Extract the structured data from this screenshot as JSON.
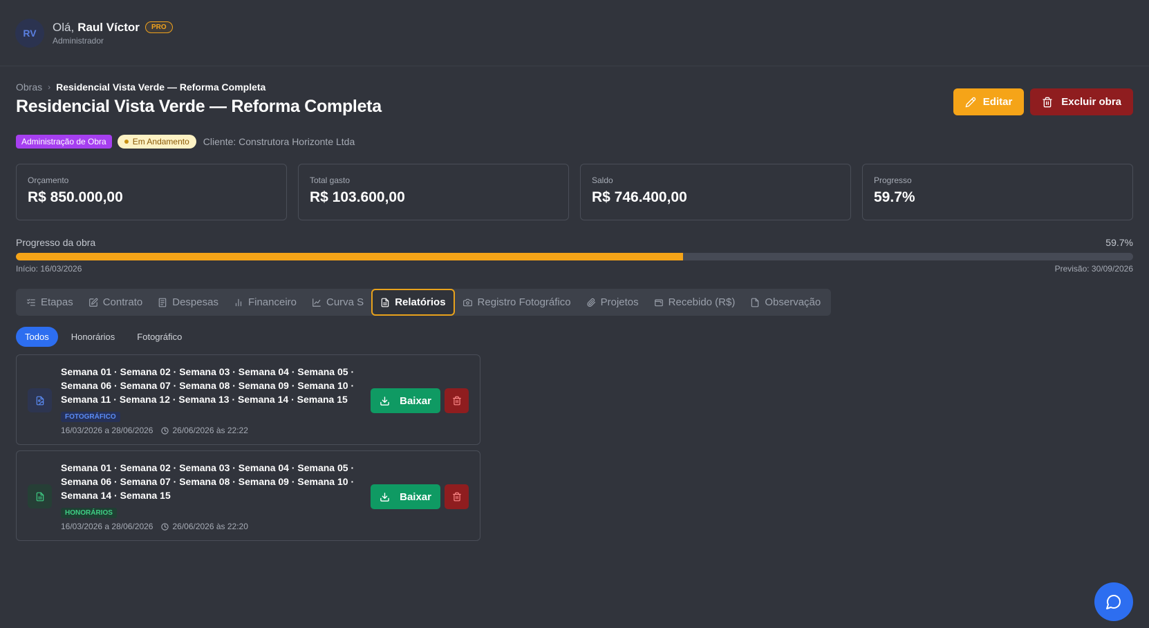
{
  "header": {
    "avatar_initials": "RV",
    "greeting": "Olá,",
    "user_name": "Raul Víctor",
    "badge": "PRO",
    "role": "Administrador"
  },
  "breadcrumb": {
    "root": "Obras",
    "current": "Residencial Vista Verde — Reforma Completa"
  },
  "page": {
    "title": "Residencial Vista Verde — Reforma Completa",
    "edit_label": "Editar",
    "delete_label": "Excluir obra"
  },
  "tags": {
    "type": "Administração de Obra",
    "status": "Em Andamento",
    "client": "Cliente: Construtora Horizonte Ltda"
  },
  "stats": [
    {
      "label": "Orçamento",
      "value": "R$ 850.000,00"
    },
    {
      "label": "Total gasto",
      "value": "R$ 103.600,00"
    },
    {
      "label": "Saldo",
      "value": "R$ 746.400,00"
    },
    {
      "label": "Progresso",
      "value": "59.7%"
    }
  ],
  "progress": {
    "label": "Progresso da obra",
    "value_text": "59.7%",
    "percent": 59.7,
    "start": "Início: 16/03/2026",
    "forecast": "Previsão: 30/09/2026"
  },
  "tabs": [
    {
      "label": "Etapas",
      "icon": "list-check-icon"
    },
    {
      "label": "Contrato",
      "icon": "edit-doc-icon"
    },
    {
      "label": "Despesas",
      "icon": "receipt-icon"
    },
    {
      "label": "Financeiro",
      "icon": "bar-chart-icon"
    },
    {
      "label": "Curva S",
      "icon": "line-chart-icon"
    },
    {
      "label": "Relatórios",
      "icon": "file-text-icon",
      "active": true
    },
    {
      "label": "Registro Fotográfico",
      "icon": "camera-icon"
    },
    {
      "label": "Projetos",
      "icon": "paperclip-icon"
    },
    {
      "label": "Recebido (R$)",
      "icon": "wallet-icon"
    },
    {
      "label": "Observação",
      "icon": "file-icon"
    }
  ],
  "filters": [
    {
      "label": "Todos",
      "active": true
    },
    {
      "label": "Honorários"
    },
    {
      "label": "Fotográfico"
    }
  ],
  "reports": [
    {
      "title_line1": "Semana 01 · Semana 02 · Semana 03 · Semana 04 · Semana 05 ·",
      "title_line2": "Semana 06 · Semana 07 · Semana 08 · Semana 09 · Semana 10 ·",
      "title_line3": "Semana 11 · Semana 12 · Semana 13 · Semana 14 · Semana 15",
      "badge": "FOTOGRÁFICO",
      "period": "16/03/2026 a 28/06/2026",
      "created": "26/06/2026 às 22:22",
      "download_label": "Baixar"
    },
    {
      "title_line1": "Semana 01 · Semana 02 · Semana 03 · Semana 04 · Semana 05 ·",
      "title_line2": "Semana 06 · Semana 07 · Semana 08 · Semana 09 · Semana 10 ·",
      "title_line3": "Semana 14 · Semana 15",
      "badge": "HONORÁRIOS",
      "period": "16/03/2026 a 28/06/2026",
      "created": "26/06/2026 às 22:20",
      "download_label": "Baixar"
    }
  ],
  "colors": {
    "background": "#31343c",
    "accent_orange": "#f5a418",
    "danger": "#8f1d1f",
    "primary_blue": "#2d6ef0",
    "success_green": "#0f9a63"
  }
}
